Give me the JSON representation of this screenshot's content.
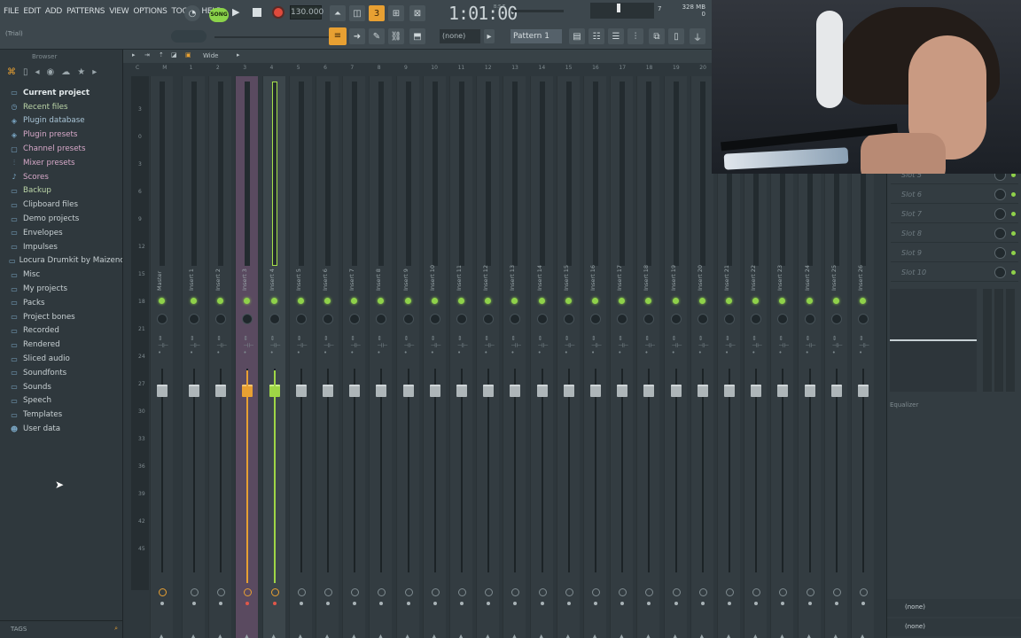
{
  "menu": [
    "FILE",
    "EDIT",
    "ADD",
    "PATTERNS",
    "VIEW",
    "OPTIONS",
    "TOOLS",
    "HELP"
  ],
  "trial": "(Trial)",
  "transport": {
    "song_label": "SONG",
    "tempo": "130.000",
    "time": "1:01:00",
    "time_unit": "B:S:T",
    "cpu": "7",
    "memory": "328 MB",
    "memory_sub": "0"
  },
  "pattern": {
    "none_label": "(none)",
    "name": "Pattern 1"
  },
  "browser": {
    "title": "Browser",
    "items": [
      {
        "label": "Current project",
        "icon": "folder-icon",
        "style": "current"
      },
      {
        "label": "Recent files",
        "icon": "recent-icon",
        "style": "green"
      },
      {
        "label": "Plugin database",
        "icon": "plugin-icon",
        "style": "blue"
      },
      {
        "label": "Plugin presets",
        "icon": "plugin-icon",
        "style": "pink"
      },
      {
        "label": "Channel presets",
        "icon": "channel-icon",
        "style": "pink"
      },
      {
        "label": "Mixer presets",
        "icon": "mixer-icon",
        "style": "pink"
      },
      {
        "label": "Scores",
        "icon": "note-icon",
        "style": "pink"
      },
      {
        "label": "Backup",
        "icon": "folder-icon",
        "style": "green"
      },
      {
        "label": "Clipboard files",
        "icon": "folder-icon",
        "style": ""
      },
      {
        "label": "Demo projects",
        "icon": "folder-icon",
        "style": ""
      },
      {
        "label": "Envelopes",
        "icon": "folder-icon",
        "style": ""
      },
      {
        "label": "Impulses",
        "icon": "folder-icon",
        "style": ""
      },
      {
        "label": "Locura Drumkit by Maizeno",
        "icon": "folder-icon",
        "style": ""
      },
      {
        "label": "Misc",
        "icon": "folder-icon",
        "style": ""
      },
      {
        "label": "My projects",
        "icon": "folder-icon",
        "style": ""
      },
      {
        "label": "Packs",
        "icon": "folder-icon",
        "style": ""
      },
      {
        "label": "Project bones",
        "icon": "folder-icon",
        "style": ""
      },
      {
        "label": "Recorded",
        "icon": "folder-icon",
        "style": ""
      },
      {
        "label": "Rendered",
        "icon": "folder-icon",
        "style": ""
      },
      {
        "label": "Sliced audio",
        "icon": "folder-icon",
        "style": ""
      },
      {
        "label": "Soundfonts",
        "icon": "folder-icon",
        "style": ""
      },
      {
        "label": "Sounds",
        "icon": "folder-icon",
        "style": ""
      },
      {
        "label": "Speech",
        "icon": "folder-icon",
        "style": ""
      },
      {
        "label": "Templates",
        "icon": "folder-icon",
        "style": ""
      },
      {
        "label": "User data",
        "icon": "user-icon",
        "style": ""
      }
    ],
    "tags_label": "TAGS"
  },
  "mixer": {
    "view_label": "Wide",
    "ruler": [
      "C",
      "M",
      "1",
      "2",
      "3",
      "4",
      "5",
      "6",
      "7",
      "8",
      "9",
      "10",
      "11",
      "12",
      "13",
      "14",
      "15",
      "16",
      "17",
      "18",
      "19",
      "20"
    ],
    "db_scale": [
      "3",
      "0",
      "3",
      "6",
      "9",
      "12",
      "15",
      "18",
      "21",
      "24",
      "27",
      "30",
      "33",
      "36",
      "39",
      "42",
      "45"
    ],
    "tracks": [
      "Master",
      "Insert 1",
      "Insert 2",
      "Insert 3",
      "Insert 4",
      "Insert 5",
      "Insert 6",
      "Insert 7",
      "Insert 8",
      "Insert 9",
      "Insert 10",
      "Insert 11",
      "Insert 12",
      "Insert 13",
      "Insert 14",
      "Insert 15",
      "Insert 16",
      "Insert 17",
      "Insert 18",
      "Insert 19",
      "Insert 20",
      "Insert 21",
      "Insert 22",
      "Insert 23",
      "Insert 24",
      "Insert 25",
      "Insert 26"
    ],
    "highlighted_track": "Insert 3",
    "selected_track": "Insert 4"
  },
  "fx_slots": [
    "Slot 5",
    "Slot 6",
    "Slot 7",
    "Slot 8",
    "Slot 9",
    "Slot 10"
  ],
  "equalizer_label": "Equalizer",
  "bottom_slots": [
    "(none)",
    "(none)"
  ],
  "colors": {
    "accent_orange": "#e8a032",
    "accent_green": "#9fd646",
    "highlight_purple": "#5a4a60"
  }
}
